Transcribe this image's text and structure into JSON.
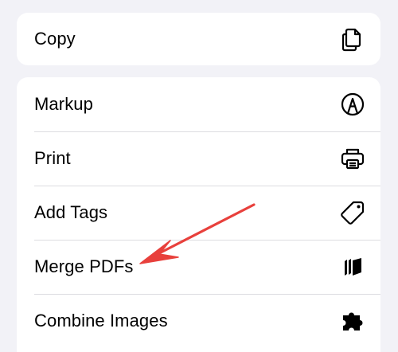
{
  "top_group": {
    "items": [
      {
        "label": "Copy",
        "icon": "copy-icon"
      }
    ]
  },
  "main_group": {
    "items": [
      {
        "label": "Markup",
        "icon": "markup-icon"
      },
      {
        "label": "Print",
        "icon": "printer-icon"
      },
      {
        "label": "Add Tags",
        "icon": "tag-icon"
      },
      {
        "label": "Merge PDFs",
        "icon": "stack-icon"
      },
      {
        "label": "Combine Images",
        "icon": "puzzle-icon"
      }
    ]
  },
  "annotation": {
    "arrow_color": "#e8403c",
    "points_to": "Merge PDFs"
  },
  "colors": {
    "background": "#f2f2f7",
    "card": "#ffffff",
    "text": "#000000",
    "separator": "#dcdce0"
  }
}
